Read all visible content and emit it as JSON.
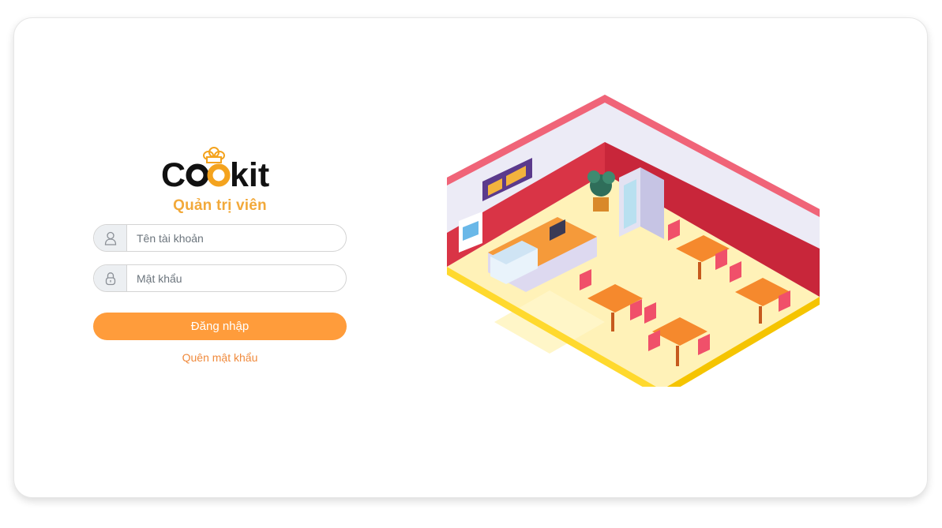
{
  "brand": {
    "logo_text": "Cookit",
    "subtitle": "Quản trị viên",
    "accent_color": "#ff9c3b",
    "subtitle_color": "#f2a93a"
  },
  "form": {
    "username": {
      "placeholder": "Tên tài khoản",
      "value": "",
      "icon": "user-icon"
    },
    "password": {
      "placeholder": "Mật khẩu",
      "value": "",
      "icon": "lock-icon"
    },
    "login_label": "Đăng nhập",
    "forgot_label": "Quên mật khẩu"
  },
  "illustration": {
    "subject": "isometric-restaurant"
  }
}
